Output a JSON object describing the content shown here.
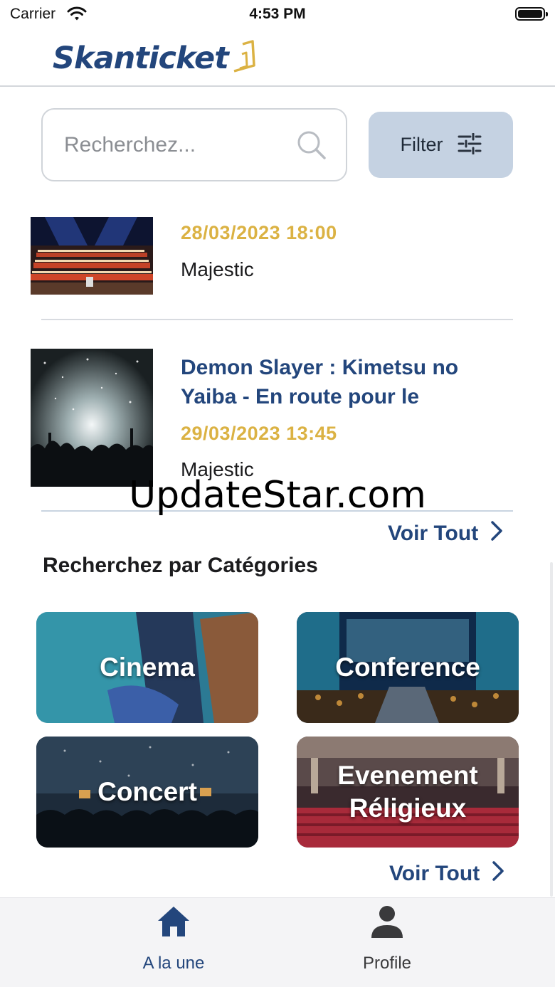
{
  "status_bar": {
    "carrier": "Carrier",
    "time": "4:53 PM"
  },
  "header": {
    "logo_text": "Skanticket"
  },
  "search": {
    "placeholder": "Recherchez...",
    "filter_label": "Filter"
  },
  "events": [
    {
      "title": "",
      "date": "28/03/2023 18:00",
      "venue": "Majestic",
      "image": "orchestra-concert-photo"
    },
    {
      "title": "Demon Slayer : Kimetsu no Yaiba - En route pour le",
      "date": "29/03/2023 13:45",
      "venue": "Majestic",
      "image": "crowd-concert-photo"
    }
  ],
  "watermark": "UpdateStar.com",
  "see_all_label": "Voir Tout",
  "categories_section": {
    "title": "Recherchez par Catégories",
    "items": [
      {
        "label": "Cinema",
        "image": "cinema-photo"
      },
      {
        "label": "Conference",
        "image": "conference-photo"
      },
      {
        "label": "Concert",
        "image": "concert-photo"
      },
      {
        "label": "Evenement Réligieux",
        "image": "theatre-hall-photo"
      }
    ]
  },
  "tab_bar": {
    "tabs": [
      {
        "label": "A la une",
        "icon": "home-icon",
        "active": true
      },
      {
        "label": "Profile",
        "icon": "person-icon",
        "active": false
      }
    ]
  },
  "colors": {
    "brand": "#23467c",
    "date": "#dbb243",
    "filter_bg": "#c5d2e2",
    "tab_active": "#23467c",
    "tab_inactive": "#3a3a3c"
  }
}
